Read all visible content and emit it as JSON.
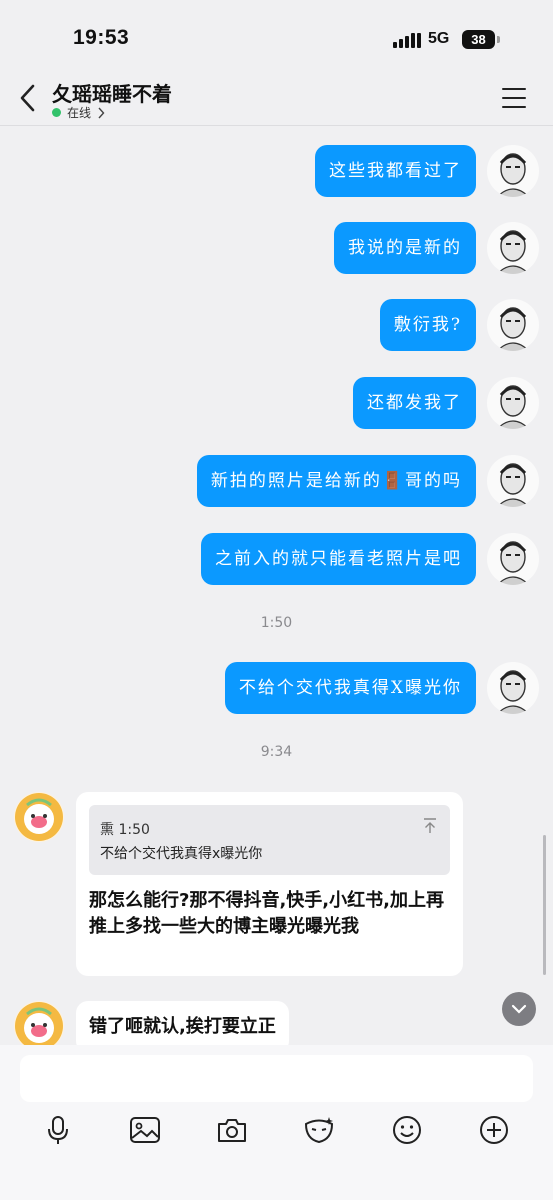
{
  "status_bar": {
    "time": "19:53",
    "network": "5G",
    "battery": "38"
  },
  "header": {
    "title": "夂瑶瑶睡不着",
    "presence": "在线"
  },
  "messages_out": [
    "这些我都看过了",
    "我说的是新的",
    "敷衍我?",
    "还都发我了",
    "新拍的照片是给新的🚪哥的吗",
    "之前入的就只能看老照片是吧"
  ],
  "timestamps": [
    "1:50",
    "9:34"
  ],
  "message_out_after_ts": "不给个交代我真得X曝光你",
  "reply": {
    "quote_sender_time": "熏 1:50",
    "quote_text": "不给个交代我真得x曝光你",
    "text": "那怎么能行?那不得抖音,快手,小红书,加上再推上多找一些大的博主曝光曝光我"
  },
  "last_message_in": "错了咂就认,挨打要立正",
  "toolbar_icons": [
    "microphone-icon",
    "image-icon",
    "camera-icon",
    "mask-icon",
    "emoji-icon",
    "plus-icon"
  ],
  "colors": {
    "outgoing_bubble": "#0b99ff",
    "online_dot": "#33c26b",
    "background": "#f0f0f2"
  }
}
